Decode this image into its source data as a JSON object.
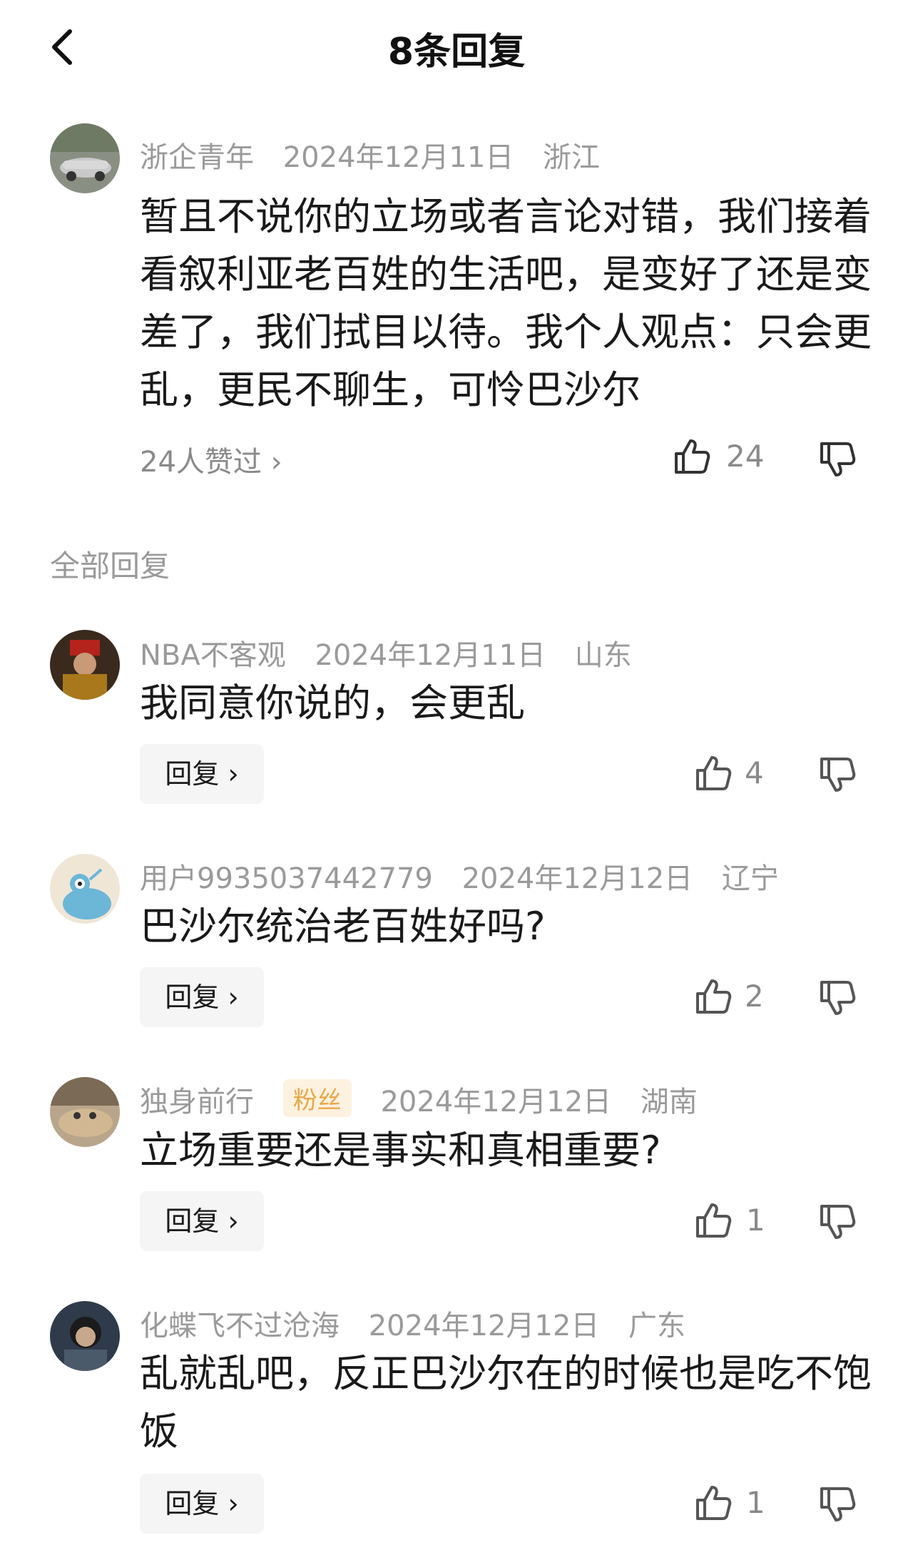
{
  "header": {
    "title": "8条回复",
    "back_icon": "chevron-left-icon"
  },
  "main_comment": {
    "username": "浙企青年",
    "date": "2024年12月11日",
    "location": "浙江",
    "text": "暂且不说你的立场或者言论对错，我们接着看叙利亚老百姓的生活吧，是变好了还是变差了，我们拭目以待。我个人观点：只会更乱，更民不聊生，可怜巴沙尔",
    "likes_summary": "24人赞过 ›",
    "like_count": "24"
  },
  "section_title": "全部回复",
  "reply_label": "回复 ›",
  "replies": [
    {
      "username": "NBA不客观",
      "date": "2024年12月11日",
      "location": "山东",
      "text": "我同意你说的，会更乱",
      "like_count": "4"
    },
    {
      "username": "用户9935037442779",
      "date": "2024年12月12日",
      "location": "辽宁",
      "text": "巴沙尔统治老百姓好吗?",
      "like_count": "2"
    },
    {
      "username": "独身前行",
      "badge": "粉丝",
      "date": "2024年12月12日",
      "location": "湖南",
      "text": "立场重要还是事实和真相重要?",
      "like_count": "1"
    },
    {
      "username": "化蝶飞不过沧海",
      "date": "2024年12月12日",
      "location": "广东",
      "text": "乱就乱吧，反正巴沙尔在的时候也是吃不饱饭",
      "like_count": "1"
    }
  ],
  "colors": {
    "meta": "#9a9a9a",
    "text": "#1a1a1a",
    "badge_bg": "#fdf1df",
    "badge_fg": "#e7a94b",
    "reply_bg": "#f5f5f5"
  }
}
